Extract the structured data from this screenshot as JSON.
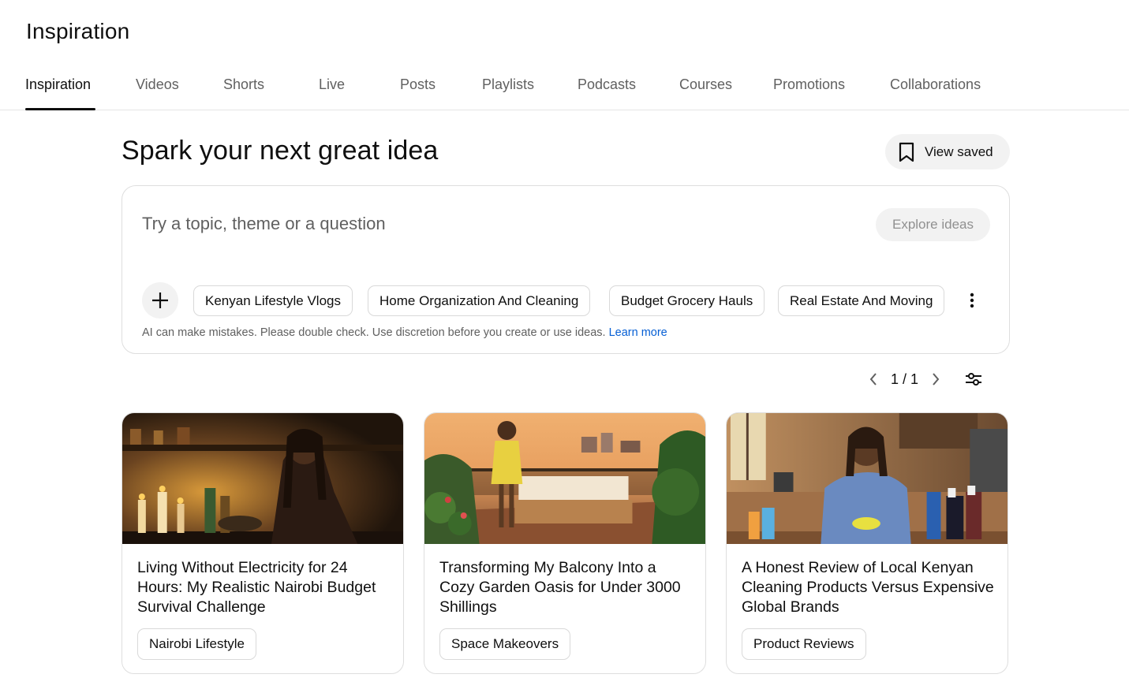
{
  "page": {
    "title": "Inspiration"
  },
  "tabs": [
    {
      "label": "Inspiration",
      "active": true
    },
    {
      "label": "Videos"
    },
    {
      "label": "Shorts"
    },
    {
      "label": "Live"
    },
    {
      "label": "Posts"
    },
    {
      "label": "Playlists"
    },
    {
      "label": "Podcasts"
    },
    {
      "label": "Courses"
    },
    {
      "label": "Promotions"
    },
    {
      "label": "Collaborations"
    }
  ],
  "main": {
    "headline": "Spark your next great idea",
    "view_saved": {
      "label": "View saved",
      "icon": "bookmark-icon"
    },
    "prompt": {
      "placeholder": "Try a topic, theme or a question",
      "value": "",
      "explore_label": "Explore ideas"
    },
    "chips": [
      "Kenyan Lifestyle Vlogs",
      "Home Organization And Cleaning",
      "Budget Grocery Hauls",
      "Real Estate And Moving"
    ],
    "disclaimer": {
      "text": "AI can make mistakes. Please double check. Use discretion before you create or use ideas. ",
      "link": "Learn more"
    },
    "pager": {
      "count": "1 / 1"
    },
    "cards": [
      {
        "title": "Living Without Electricity for 24 Hours: My Realistic Nairobi Budget Survival Challenge",
        "tag": "Nairobi Lifestyle"
      },
      {
        "title": "Transforming My Balcony Into a Cozy Garden Oasis for Under 3000 Shillings",
        "tag": "Space Makeovers"
      },
      {
        "title": "A Honest Review of Local Kenyan Cleaning Products Versus Expensive Global Brands",
        "tag": "Product Reviews"
      }
    ]
  },
  "colors": {
    "link": "#065fd4",
    "text": "#0f0f0f",
    "muted": "#606060",
    "chip_bg": "#f2f2f2",
    "border": "#dedede"
  }
}
